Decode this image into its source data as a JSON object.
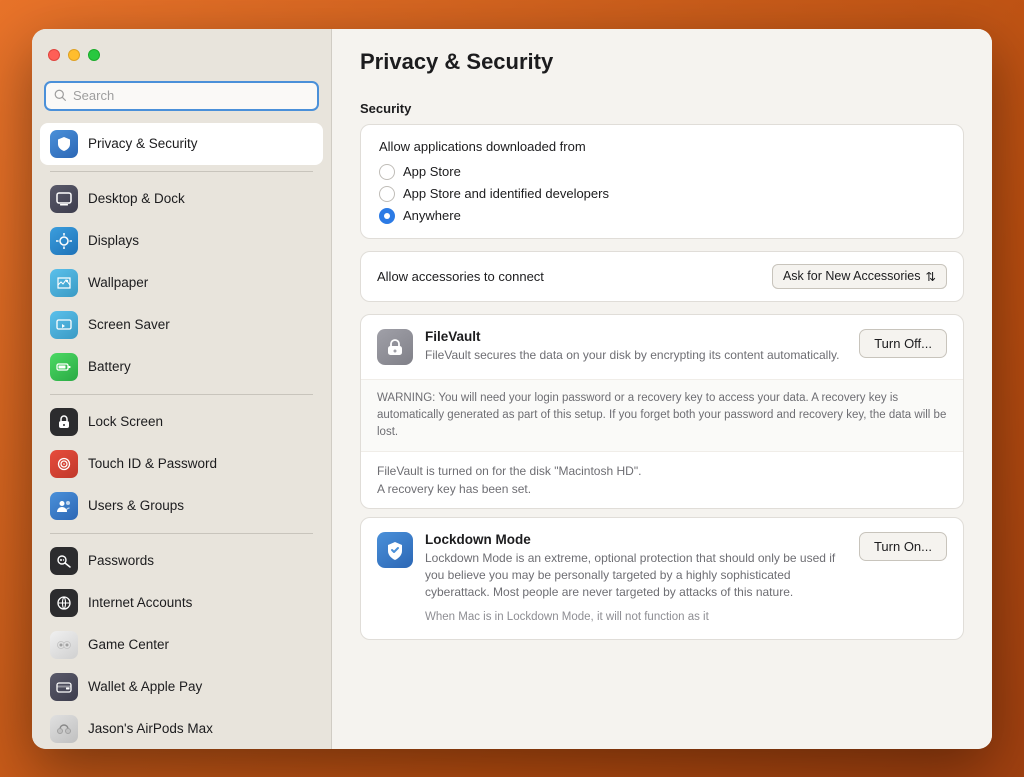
{
  "window": {
    "title": "Privacy & Security"
  },
  "search": {
    "placeholder": "Search"
  },
  "sidebar": {
    "items": [
      {
        "id": "privacy-security",
        "label": "Privacy & Security",
        "icon_class": "icon-privacy",
        "icon_char": "🔒",
        "active": true,
        "group": 1
      },
      {
        "id": "desktop-dock",
        "label": "Desktop & Dock",
        "icon_class": "icon-desktop",
        "icon_char": "🖥",
        "active": false,
        "group": 2
      },
      {
        "id": "displays",
        "label": "Displays",
        "icon_class": "icon-displays",
        "icon_char": "✦",
        "active": false,
        "group": 2
      },
      {
        "id": "wallpaper",
        "label": "Wallpaper",
        "icon_class": "icon-wallpaper",
        "icon_char": "❄",
        "active": false,
        "group": 2
      },
      {
        "id": "screen-saver",
        "label": "Screen Saver",
        "icon_class": "icon-screensaver",
        "icon_char": "⬡",
        "active": false,
        "group": 2
      },
      {
        "id": "battery",
        "label": "Battery",
        "icon_class": "icon-battery",
        "icon_char": "⚡",
        "active": false,
        "group": 2
      },
      {
        "id": "lock-screen",
        "label": "Lock Screen",
        "icon_class": "icon-lockscreen",
        "icon_char": "🔒",
        "active": false,
        "group": 3
      },
      {
        "id": "touch-id-password",
        "label": "Touch ID & Password",
        "icon_class": "icon-touchid",
        "icon_char": "⊙",
        "active": false,
        "group": 3
      },
      {
        "id": "users-groups",
        "label": "Users & Groups",
        "icon_class": "icon-users",
        "icon_char": "👥",
        "active": false,
        "group": 3
      },
      {
        "id": "passwords",
        "label": "Passwords",
        "icon_class": "icon-passwords",
        "icon_char": "🗝",
        "active": false,
        "group": 4
      },
      {
        "id": "internet-accounts",
        "label": "Internet Accounts",
        "icon_class": "icon-internet",
        "icon_char": "@",
        "active": false,
        "group": 4
      },
      {
        "id": "game-center",
        "label": "Game Center",
        "icon_class": "icon-gamecenter",
        "icon_char": "◉",
        "active": false,
        "group": 4
      },
      {
        "id": "wallet-apple-pay",
        "label": "Wallet & Apple Pay",
        "icon_class": "icon-wallet",
        "icon_char": "💳",
        "active": false,
        "group": 4
      },
      {
        "id": "jasons-airpods",
        "label": "Jason's AirPods Max",
        "icon_class": "icon-airpods",
        "icon_char": "🎧",
        "active": false,
        "group": 4
      }
    ]
  },
  "main": {
    "title": "Privacy & Security",
    "section_security": "Security",
    "allow_download_label": "Allow applications downloaded from",
    "radio_options": [
      {
        "id": "app-store",
        "label": "App Store",
        "selected": false
      },
      {
        "id": "app-store-dev",
        "label": "App Store and identified developers",
        "selected": false
      },
      {
        "id": "anywhere",
        "label": "Anywhere",
        "selected": true
      }
    ],
    "accessories_label": "Allow accessories to connect",
    "accessories_value": "Ask for New Accessories",
    "filevault": {
      "title": "FileVault",
      "description": "FileVault secures the data on your disk by encrypting its content automatically.",
      "button": "Turn Off...",
      "warning": "WARNING: You will need your login password or a recovery key to access your data. A recovery key is automatically generated as part of this setup. If you forget both your password and recovery key, the data will be lost.",
      "status_line1": "FileVault is turned on for the disk \"Macintosh HD\".",
      "status_line2": "A recovery key has been set."
    },
    "lockdown": {
      "title": "Lockdown Mode",
      "description": "Lockdown Mode is an extreme, optional protection that should only be used if you believe you may be personally targeted by a highly sophisticated cyberattack. Most people are never targeted by attacks of this nature.",
      "more_text": "When Mac is in Lockdown Mode, it will not function as it",
      "button": "Turn On..."
    }
  },
  "icons": {
    "search": "🔍",
    "chevron_up_down": "⇅"
  }
}
